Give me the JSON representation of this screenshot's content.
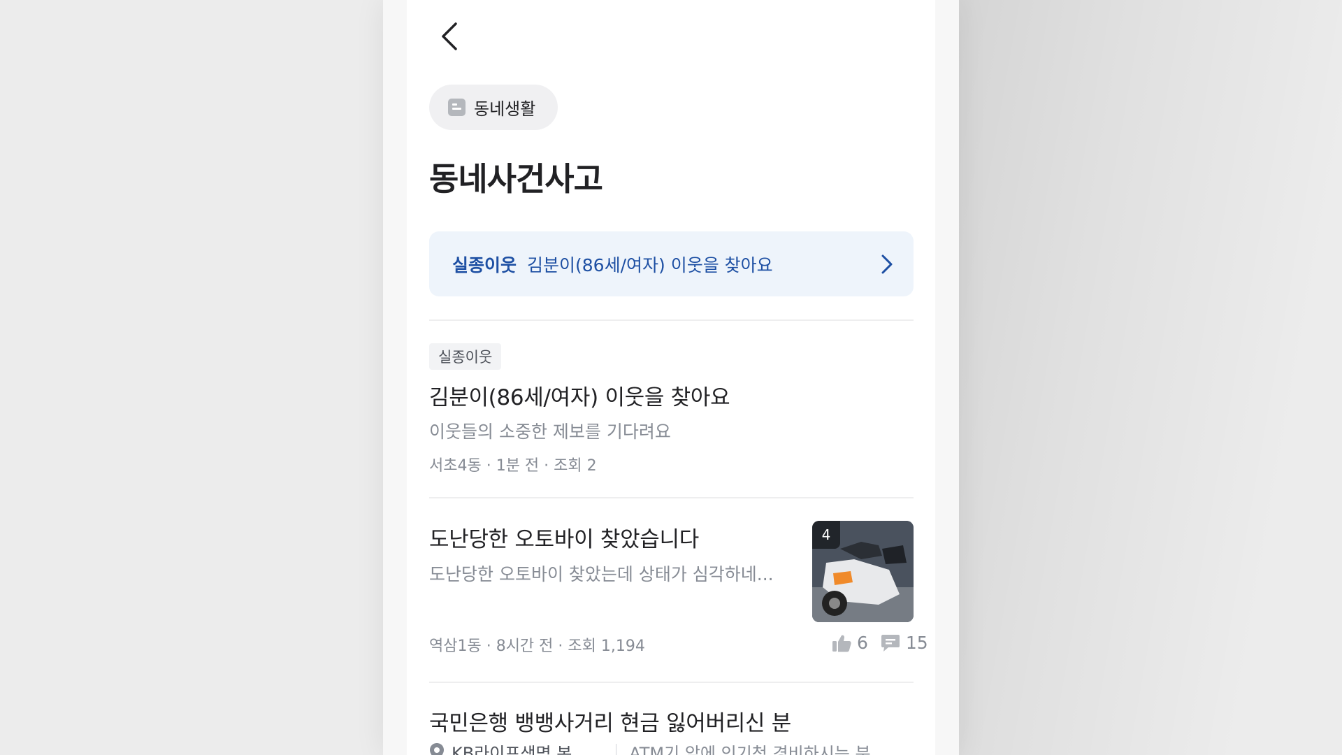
{
  "header": {
    "category_label": "동네생활",
    "page_title": "동네사건사고"
  },
  "banner": {
    "tag": "실종이웃",
    "text": "김분이(86세/여자) 이웃을 찾아요"
  },
  "posts": [
    {
      "badge": "실종이웃",
      "title": "김분이(86세/여자) 이웃을 찾아요",
      "subtitle": "이웃들의 소중한 제보를 기다려요",
      "meta": "서초4동 · 1분 전 · 조회 2"
    },
    {
      "title": "도난당한 오토바이 찾았습니다",
      "subtitle": "도난당한 오토바이 찾았는데 상태가 심각하네...",
      "meta": "역삼1동 · 8시간 전 · 조회 1,194",
      "image_count": "4",
      "likes": "6",
      "comments": "15"
    },
    {
      "title": "국민은행 뱅뱅사거리 현금 잃어버리신 분",
      "place": "KB라이프생명 본...",
      "place_snippet": "ATM기 앞에 인기척 경비하시는 분"
    }
  ],
  "colors": {
    "accent": "#1d4fa3",
    "banner_bg": "#eef4fb",
    "muted_text": "#868b94"
  },
  "icons": [
    "chevron-left-icon",
    "board-icon",
    "chevron-right-icon",
    "thumbs-up-icon",
    "comment-icon",
    "location-pin-icon"
  ]
}
